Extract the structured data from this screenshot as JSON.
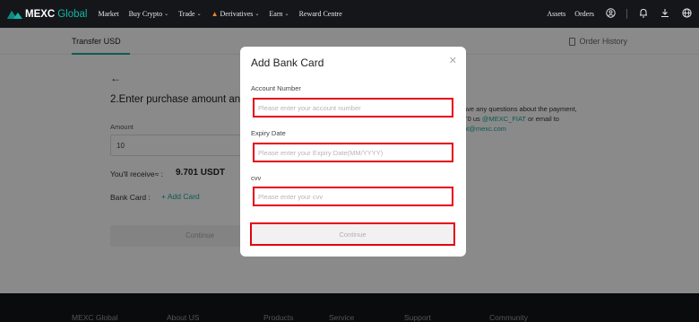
{
  "nav": {
    "logo_main": "MEXC",
    "logo_sub": "Global",
    "items": [
      {
        "label": "Market",
        "has_dropdown": false
      },
      {
        "label": "Buy Crypto",
        "has_dropdown": true
      },
      {
        "label": "Trade",
        "has_dropdown": true
      },
      {
        "label": "Derivatives",
        "has_dropdown": true
      },
      {
        "label": "Earn",
        "has_dropdown": true
      },
      {
        "label": "Reward Centre",
        "has_dropdown": false
      }
    ],
    "right": {
      "assets": "Assets",
      "orders": "Orders",
      "icons": [
        "user-icon",
        "bell-icon",
        "download-icon",
        "globe-icon"
      ]
    }
  },
  "page": {
    "tab": "Transfer USD",
    "order_history": "Order History",
    "step_title": "2.Enter purchase amount and p",
    "amount_label": "Amount",
    "amount_value": "10",
    "receive_label": "You'll receive≈ :",
    "receive_value": "9.701 USDT",
    "bank_card_label": "Bank Card :",
    "add_card": "+ Add Card",
    "continue_label": "Continue",
    "help_line1": "ave any questions about the payment,",
    "help_line2_prefix": "T0 us",
    "help_line2_link": "@MEXC_FIAT",
    "help_line2_suffix": "or email to",
    "help_line3": "nt@mexc.com"
  },
  "footer": {
    "links": [
      "MEXC Global",
      "About US",
      "Products",
      "Service",
      "Support",
      "Community"
    ]
  },
  "modal": {
    "title": "Add Bank Card",
    "account_label": "Account Number",
    "account_placeholder": "Please enter your account number",
    "expiry_label": "Expiry Date",
    "expiry_placeholder": "Please enter your Expiry Date(MM/YYYY)",
    "cvv_label": "cvv",
    "cvv_placeholder": "Please enter your cvv",
    "continue_label": "Continue"
  },
  "colors": {
    "accent": "#18a89b",
    "highlight": "#e60012",
    "nav_bg": "#15161a"
  }
}
